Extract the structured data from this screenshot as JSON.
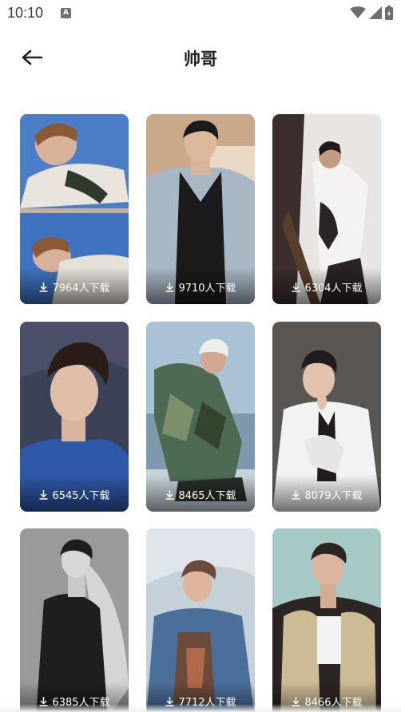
{
  "status": {
    "time": "10:10",
    "notif_badge": "A"
  },
  "header": {
    "title": "帅哥",
    "back_icon": "arrow-left-icon"
  },
  "wallpapers": [
    {
      "downloads": "7964人下载",
      "bg": "#3f6fb8",
      "accent": "#d8b19a",
      "dark": "#5a3a28"
    },
    {
      "downloads": "9710人下载",
      "bg": "#c9a98a",
      "accent": "#a8b7c4",
      "dark": "#1b1b1b"
    },
    {
      "downloads": "6304人下载",
      "bg": "#e9e5e3",
      "accent": "#f5f3f2",
      "dark": "#2a2424"
    },
    {
      "downloads": "6545人下载",
      "bg": "#3b4258",
      "accent": "#2e58a8",
      "dark": "#2a1d18"
    },
    {
      "downloads": "8465人下载",
      "bg": "#a9c2d6",
      "accent": "#4d6a52",
      "dark": "#2a2f2a"
    },
    {
      "downloads": "8079人下载",
      "bg": "#5a5653",
      "accent": "#f2f2f2",
      "dark": "#201c1c"
    },
    {
      "downloads": "6385人下载",
      "bg": "#9a9a9a",
      "accent": "#d5d5d5",
      "dark": "#1e1e1e"
    },
    {
      "downloads": "7712人下载",
      "bg": "#c6d0d8",
      "accent": "#4a6f9a",
      "dark": "#6d4b3a"
    },
    {
      "downloads": "8466人下载",
      "bg": "#a7c9c6",
      "accent": "#cdbb95",
      "dark": "#2b2623"
    }
  ],
  "icons": {
    "download": "download-icon",
    "wifi": "wifi-icon",
    "signal": "signal-icon",
    "battery": "battery-icon"
  }
}
